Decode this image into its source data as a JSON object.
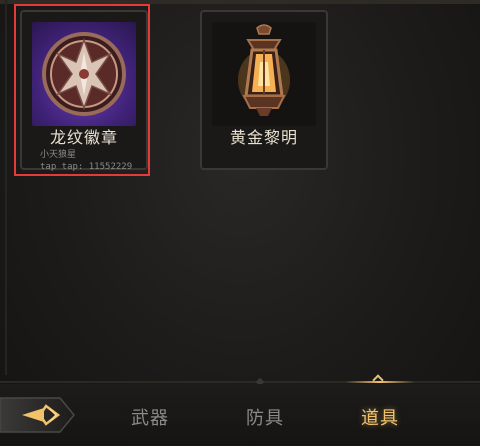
{
  "inventory": {
    "items": [
      {
        "name": "龙纹徽章",
        "icon": "dragon-badge-icon",
        "selected": true
      },
      {
        "name": "黄金黎明",
        "icon": "golden-lantern-icon",
        "selected": false
      }
    ],
    "selection_color": "#e53a3a"
  },
  "watermark": {
    "line1": "小天狼星",
    "line2": "tap tap: 11552229"
  },
  "tabs": {
    "weapons": "武器",
    "armor": "防具",
    "items": "道具",
    "active": "items"
  },
  "theme": {
    "accent": "#f2c26a",
    "inactive_text": "#8c8a86",
    "background": "#1c1b1a"
  }
}
